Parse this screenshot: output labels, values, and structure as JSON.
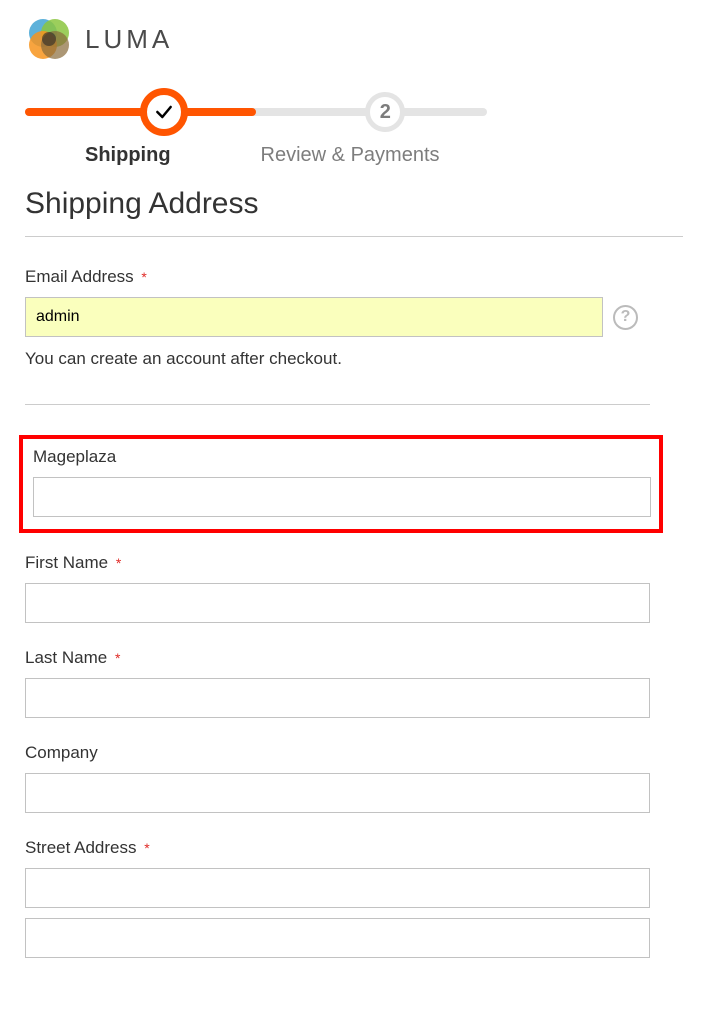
{
  "brand": {
    "name": "LUMA"
  },
  "progress": {
    "steps": [
      {
        "label": "Shipping",
        "state": "active"
      },
      {
        "label": "Review & Payments",
        "state": "upcoming",
        "number": "2"
      }
    ]
  },
  "section": {
    "title": "Shipping Address"
  },
  "fields": {
    "email": {
      "label": "Email Address",
      "value": "admin",
      "required": true,
      "hint": "You can create an account after checkout."
    },
    "custom": {
      "label": "Mageplaza",
      "value": "",
      "required": false
    },
    "first_name": {
      "label": "First Name",
      "value": "",
      "required": true
    },
    "last_name": {
      "label": "Last Name",
      "value": "",
      "required": true
    },
    "company": {
      "label": "Company",
      "value": "",
      "required": false
    },
    "street": {
      "label": "Street Address",
      "line1": "",
      "line2": "",
      "required": true
    }
  },
  "required_marker": "*"
}
